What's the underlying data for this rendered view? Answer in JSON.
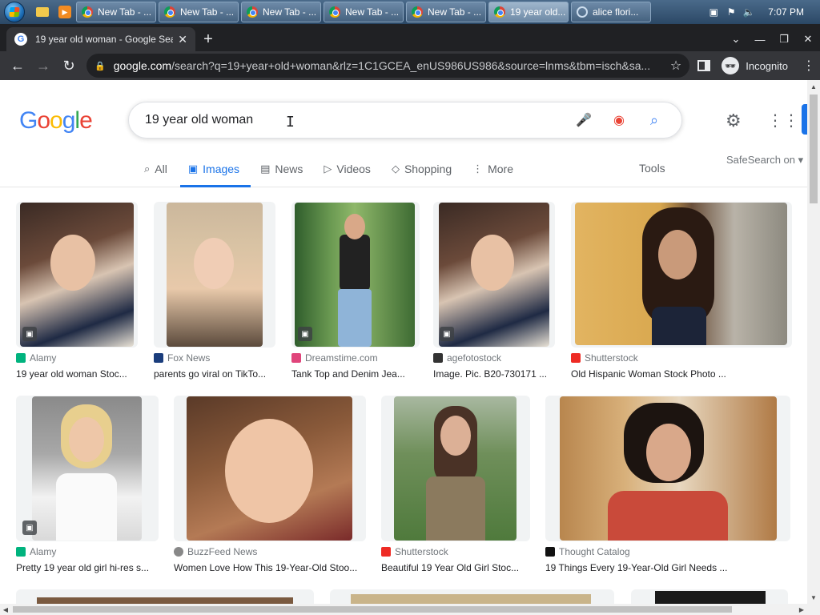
{
  "taskbar": {
    "tabs": [
      {
        "label": "New Tab - ...",
        "active": false
      },
      {
        "label": "New Tab - ...",
        "active": false
      },
      {
        "label": "New Tab - ...",
        "active": false
      },
      {
        "label": "New Tab - ...",
        "active": false
      },
      {
        "label": "New Tab - ...",
        "active": false
      },
      {
        "label": "19 year old...",
        "active": true
      },
      {
        "label": "alice flori...",
        "active": false
      }
    ],
    "clock": "7:07 PM"
  },
  "browser": {
    "tab_title": "19 year old woman - Google Sea",
    "url_host": "google.com",
    "url_rest": "/search?q=19+year+old+woman&rlz=1C1GCEA_enUS986US986&source=lnms&tbm=isch&sa...",
    "incognito_label": "Incognito"
  },
  "google": {
    "logo": [
      "G",
      "o",
      "o",
      "g",
      "l",
      "e"
    ],
    "query": "19 year old woman",
    "tabs": [
      {
        "label": "All",
        "icon": "search-icon"
      },
      {
        "label": "Images",
        "icon": "image-icon",
        "active": true
      },
      {
        "label": "News",
        "icon": "news-icon"
      },
      {
        "label": "Videos",
        "icon": "video-icon"
      },
      {
        "label": "Shopping",
        "icon": "tag-icon"
      },
      {
        "label": "More",
        "icon": "more-dots-icon"
      }
    ],
    "tools": "Tools",
    "safesearch": "SafeSearch on"
  },
  "results": [
    {
      "source": "Alamy",
      "title": "19 year old woman Stoc...",
      "color": "#00b37e",
      "has_badge": true
    },
    {
      "source": "Fox News",
      "title": "parents go viral on TikTo...",
      "color": "#1a3d7c",
      "has_badge": false
    },
    {
      "source": "Dreamstime.com",
      "title": "Tank Top and Denim Jea...",
      "color": "#e0457b",
      "has_badge": true
    },
    {
      "source": "agefotostock",
      "title": "Image. Pic. B20-730171 ...",
      "color": "#333333",
      "has_badge": true
    },
    {
      "source": "Shutterstock",
      "title": "Old Hispanic Woman Stock Photo ...",
      "color": "#ee2b24",
      "has_badge": false
    },
    {
      "source": "Alamy",
      "title": "Pretty 19 year old girl hi-res s...",
      "color": "#00b37e",
      "has_badge": true
    },
    {
      "source": "BuzzFeed News",
      "title": "Women Love How This 19-Year-Old Stoo...",
      "color": "#888888",
      "has_badge": false
    },
    {
      "source": "Shutterstock",
      "title": "Beautiful 19 Year Old Girl Stoc...",
      "color": "#ee2b24",
      "has_badge": false
    },
    {
      "source": "Thought Catalog",
      "title": "19 Things Every 19-Year-Old Girl Needs ...",
      "color": "#111111",
      "has_badge": false
    }
  ]
}
